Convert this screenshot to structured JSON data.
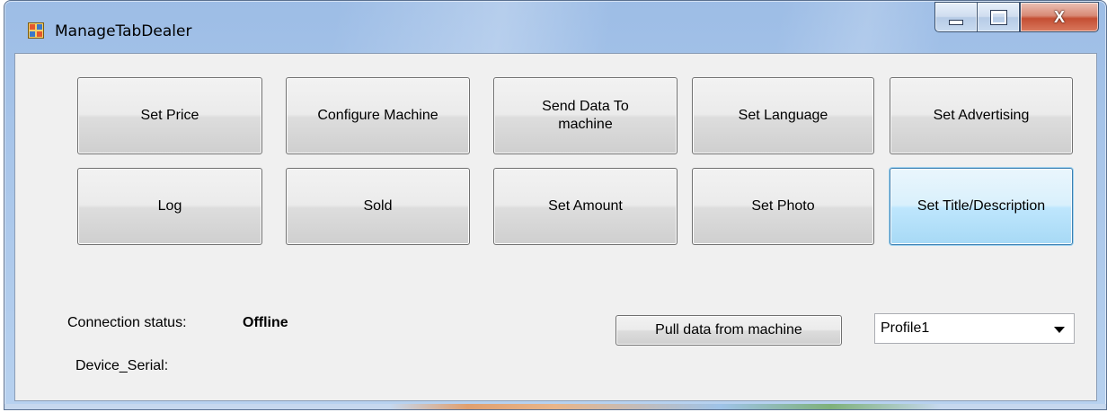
{
  "window": {
    "title": "ManageTabDealer",
    "minimize_glyph": "minimize-icon",
    "maximize_glyph": "maximize-icon",
    "close_label": "X"
  },
  "buttons_row1": [
    {
      "label": "Set Price"
    },
    {
      "label": "Configure Machine"
    },
    {
      "label": "Send Data To\nmachine"
    },
    {
      "label": "Set Language"
    },
    {
      "label": "Set Advertising"
    }
  ],
  "buttons_row2": [
    {
      "label": "Log"
    },
    {
      "label": "Sold"
    },
    {
      "label": "Set Amount"
    },
    {
      "label": "Set Photo"
    },
    {
      "label": "Set Title/Description"
    }
  ],
  "status": {
    "connection_label": "Connection status:",
    "connection_value": "Offline",
    "device_serial_label": "Device_Serial:"
  },
  "pull_button": {
    "label": "Pull data from machine"
  },
  "profile_select": {
    "selected": "Profile1"
  },
  "colors": {
    "focus_border": "#3c7fb1",
    "client_bg": "#f0f0f0"
  }
}
